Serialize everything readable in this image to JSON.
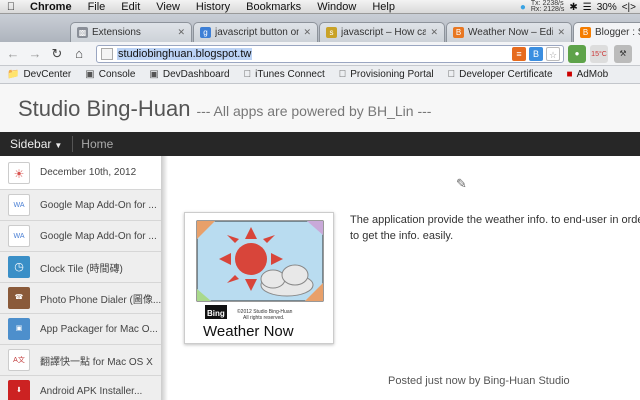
{
  "menubar": {
    "app": "Chrome",
    "items": [
      "File",
      "Edit",
      "View",
      "History",
      "Bookmarks",
      "Window",
      "Help"
    ],
    "net_tx": "2238/s",
    "net_rx": "2128/s",
    "tx_label": "Tx:",
    "rx_label": "Rx:",
    "battery": "30%"
  },
  "tabs": [
    {
      "title": "Extensions",
      "color": "#8a8f98"
    },
    {
      "title": "javascript button on",
      "color": "#3d7fd6"
    },
    {
      "title": "javascript – How can",
      "color": "#c9a227"
    },
    {
      "title": "Weather Now – Edit",
      "color": "#e87722"
    },
    {
      "title": "Blogger : Studi",
      "color": "#f57d00"
    }
  ],
  "toolbar": {
    "url": "studiobinghuan.blogspot.tw",
    "weather_badge": "15°C"
  },
  "bookmarks": [
    {
      "label": "DevCenter",
      "icon": "folder-icon"
    },
    {
      "label": "Console",
      "icon": "page-icon"
    },
    {
      "label": "DevDashboard",
      "icon": "page-icon"
    },
    {
      "label": "iTunes Connect",
      "icon": "apple-icon"
    },
    {
      "label": "Provisioning Portal",
      "icon": "apple-icon"
    },
    {
      "label": "Developer Certificate",
      "icon": "apple-icon"
    },
    {
      "label": "AdMob",
      "icon": "admob-icon"
    }
  ],
  "blog": {
    "title": "Studio Bing-Huan",
    "description": "--- All apps are powered by BH_Lin ---",
    "nav_sidebar": "Sidebar",
    "nav_home": "Home",
    "sidebar": [
      {
        "label": "December 10th, 2012",
        "thumb": "#d9534f"
      },
      {
        "label": "Google Map Add-On for ...",
        "thumb": "#4a7fd4"
      },
      {
        "label": "Google Map Add-On for ...",
        "thumb": "#4a7fd4"
      },
      {
        "label": "Clock Tile (時間磚)",
        "thumb": "#3a8fc7"
      },
      {
        "label": "Photo Phone Dialer (圖像...",
        "thumb": "#8a5a3a"
      },
      {
        "label": "App Packager for Mac O...",
        "thumb": "#4d8fcc"
      },
      {
        "label": "翻譯快一點 for Mac OS X",
        "thumb": "#c23b3b"
      },
      {
        "label": "Android APK Installer...",
        "thumb": "#cc2222"
      }
    ],
    "image_caption_small": "©2012 Studio Bing-Huan",
    "image_caption_rights": "All rights reserved.",
    "image_logo": "Bing",
    "image_title": "Weather Now",
    "post_text": "The application provide the weather info. to end-user in order to get the info. easily.",
    "posted_prefix": "Posted just now by",
    "posted_author": "Bing-Huan Studio"
  }
}
